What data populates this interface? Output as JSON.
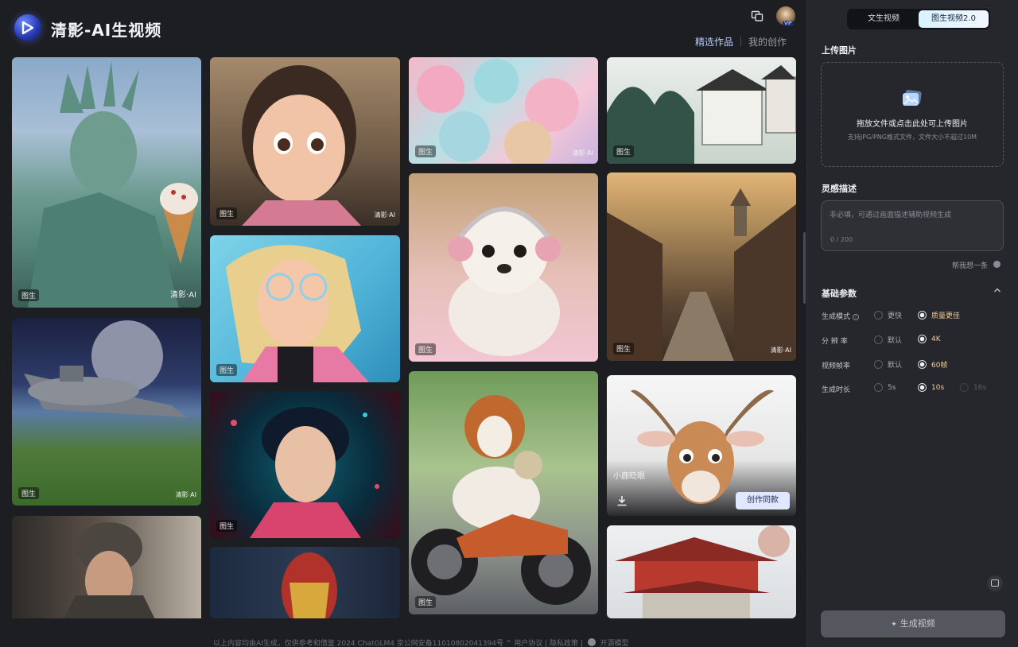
{
  "app": {
    "title": "清影-AI生视频"
  },
  "header": {
    "tabs": [
      "精选作品",
      "我的创作"
    ],
    "active_tab": 0
  },
  "gallery": {
    "items": [
      {
        "tag": "图生",
        "watermark": "清影·AI",
        "bg": "statue"
      },
      {
        "tag": "图生",
        "watermark": "清影·AI",
        "bg": "ship"
      },
      {
        "tag": "",
        "watermark": "",
        "bg": "woman-hat"
      },
      {
        "tag": "图生",
        "watermark": "清影·AI",
        "bg": "girl"
      },
      {
        "tag": "图生",
        "watermark": "",
        "bg": "blonde"
      },
      {
        "tag": "图生",
        "watermark": "",
        "bg": "chinese-girl"
      },
      {
        "tag": "",
        "watermark": "",
        "bg": "ironman"
      },
      {
        "tag": "图生",
        "watermark": "清影·AI",
        "bg": "fluff"
      },
      {
        "tag": "图生",
        "watermark": "",
        "bg": "puppy"
      },
      {
        "tag": "图生",
        "watermark": "",
        "bg": "dog-moto"
      },
      {
        "tag": "图生",
        "watermark": "",
        "bg": "ink-village"
      },
      {
        "tag": "图生",
        "watermark": "清影·AI",
        "bg": "street"
      },
      {
        "tag": "",
        "watermark": "",
        "bg": "antelope",
        "title": "小鹿眨眼",
        "action": "创作同款"
      },
      {
        "tag": "",
        "watermark": "",
        "bg": "temple"
      }
    ]
  },
  "footer": {
    "text": "以上内容均由AI生成，仅供参考和借鉴    2024 ChatGLM4 京公网安备11010802041394号 ^ 用户协议 | 隐私政策 |",
    "link": "开源模型"
  },
  "panel": {
    "mode_tabs": [
      "文生视频",
      "图生视频2.0"
    ],
    "active_mode": 1,
    "upload": {
      "title": "上传图片",
      "main": "拖放文件或点击此处可上传图片",
      "hint": "支持JPG/PNG格式文件，文件大小不超过10M"
    },
    "desc": {
      "title": "灵感描述",
      "placeholder": "非必填，可通过画面描述辅助视频生成",
      "count": "0 / 200",
      "help": "帮我想一条"
    },
    "params": {
      "title": "基础参数",
      "rows": [
        {
          "label": "生成模式",
          "options": [
            "更快",
            "质量更佳"
          ],
          "selected": 1
        },
        {
          "label": "分 辨 率",
          "options": [
            "默认",
            "4K"
          ],
          "selected": 1
        },
        {
          "label": "视频帧率",
          "options": [
            "默认",
            "60帧"
          ],
          "selected": 1
        },
        {
          "label": "生成时长",
          "options": [
            "5s",
            "10s",
            "16s"
          ],
          "selected": 1
        }
      ]
    },
    "generate": "生成视频"
  },
  "colors": {
    "accent": "#b9cbff",
    "selected_option": "#f1cc9a",
    "panel_bg": "#26272c",
    "page_bg": "#1d1e22"
  }
}
